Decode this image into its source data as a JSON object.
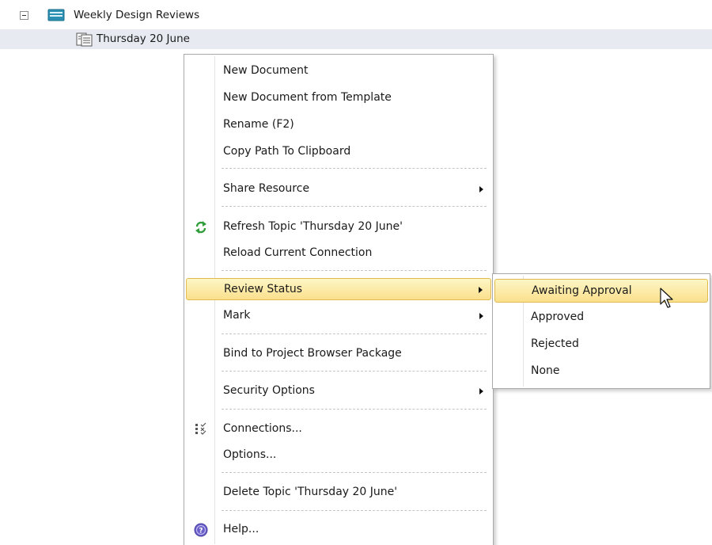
{
  "tree": {
    "root_label": "Weekly Design Reviews",
    "child_label": "Thursday 20 June"
  },
  "menu": {
    "items": [
      {
        "label": "New Document"
      },
      {
        "label": "New Document from Template"
      },
      {
        "label": "Rename (F2)"
      },
      {
        "label": "Copy Path To Clipboard"
      },
      {
        "label": "Share Resource",
        "submenu": true
      },
      {
        "label": "Refresh Topic 'Thursday 20 June'",
        "icon": "refresh-icon"
      },
      {
        "label": "Reload Current Connection"
      },
      {
        "label": "Review Status",
        "submenu": true,
        "highlighted": true
      },
      {
        "label": "Mark",
        "submenu": true
      },
      {
        "label": "Bind to Project Browser Package"
      },
      {
        "label": "Security Options",
        "submenu": true
      },
      {
        "label": "Connections...",
        "icon": "connections-icon"
      },
      {
        "label": "Options..."
      },
      {
        "label": "Delete Topic 'Thursday 20 June'"
      },
      {
        "label": "Help...",
        "icon": "help-icon"
      }
    ]
  },
  "submenu": {
    "items": [
      {
        "label": "Awaiting Approval",
        "highlighted": true
      },
      {
        "label": "Approved"
      },
      {
        "label": "Rejected"
      },
      {
        "label": "None"
      }
    ]
  },
  "colors": {
    "highlight_top": "#fdf6c5",
    "highlight_bottom": "#fbe08d",
    "highlight_border": "#e1b951",
    "selected_row": "#e7ebf1"
  }
}
